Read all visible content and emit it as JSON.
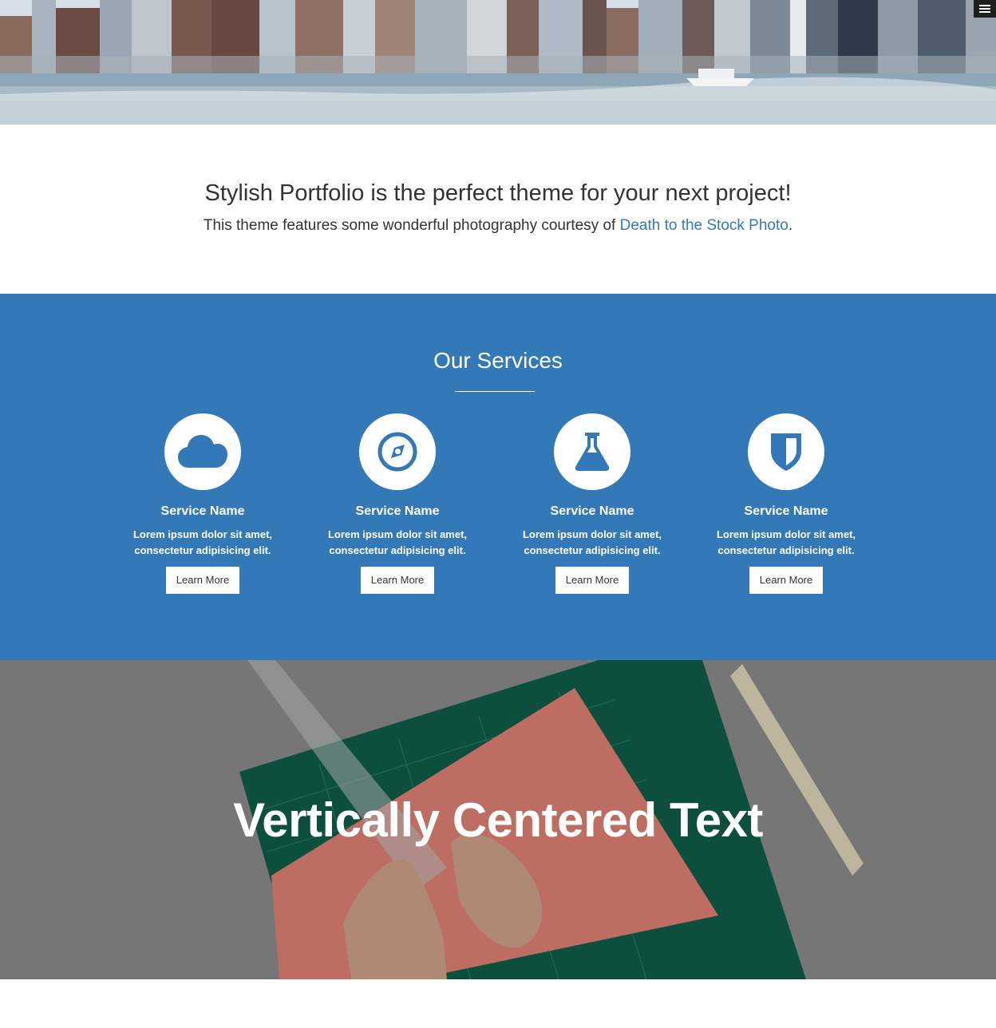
{
  "hero": {
    "menu_toggle_icon": "hamburger-menu-icon"
  },
  "about": {
    "heading": "Stylish Portfolio is the perfect theme for your next project!",
    "text_before_link": "This theme features some wonderful photography courtesy of ",
    "link_text": "Death to the Stock Photo",
    "text_after_link": ".",
    "link_color": "#337ab7"
  },
  "services": {
    "heading": "Our Services",
    "background_color": "#3479b7",
    "items": [
      {
        "icon": "cloud-icon",
        "title": "Service Name",
        "desc_line1": "Lorem ipsum dolor sit amet,",
        "desc_line2": "consectetur adipisicing elit.",
        "button": "Learn More"
      },
      {
        "icon": "compass-icon",
        "title": "Service Name",
        "desc_line1": "Lorem ipsum dolor sit amet,",
        "desc_line2": "consectetur adipisicing elit.",
        "button": "Learn More"
      },
      {
        "icon": "flask-icon",
        "title": "Service Name",
        "desc_line1": "Lorem ipsum dolor sit amet,",
        "desc_line2": "consectetur adipisicing elit.",
        "button": "Learn More"
      },
      {
        "icon": "shield-icon",
        "title": "Service Name",
        "desc_line1": "Lorem ipsum dolor sit amet,",
        "desc_line2": "consectetur adipisicing elit.",
        "button": "Learn More"
      }
    ]
  },
  "callout": {
    "heading": "Vertically Centered Text"
  }
}
